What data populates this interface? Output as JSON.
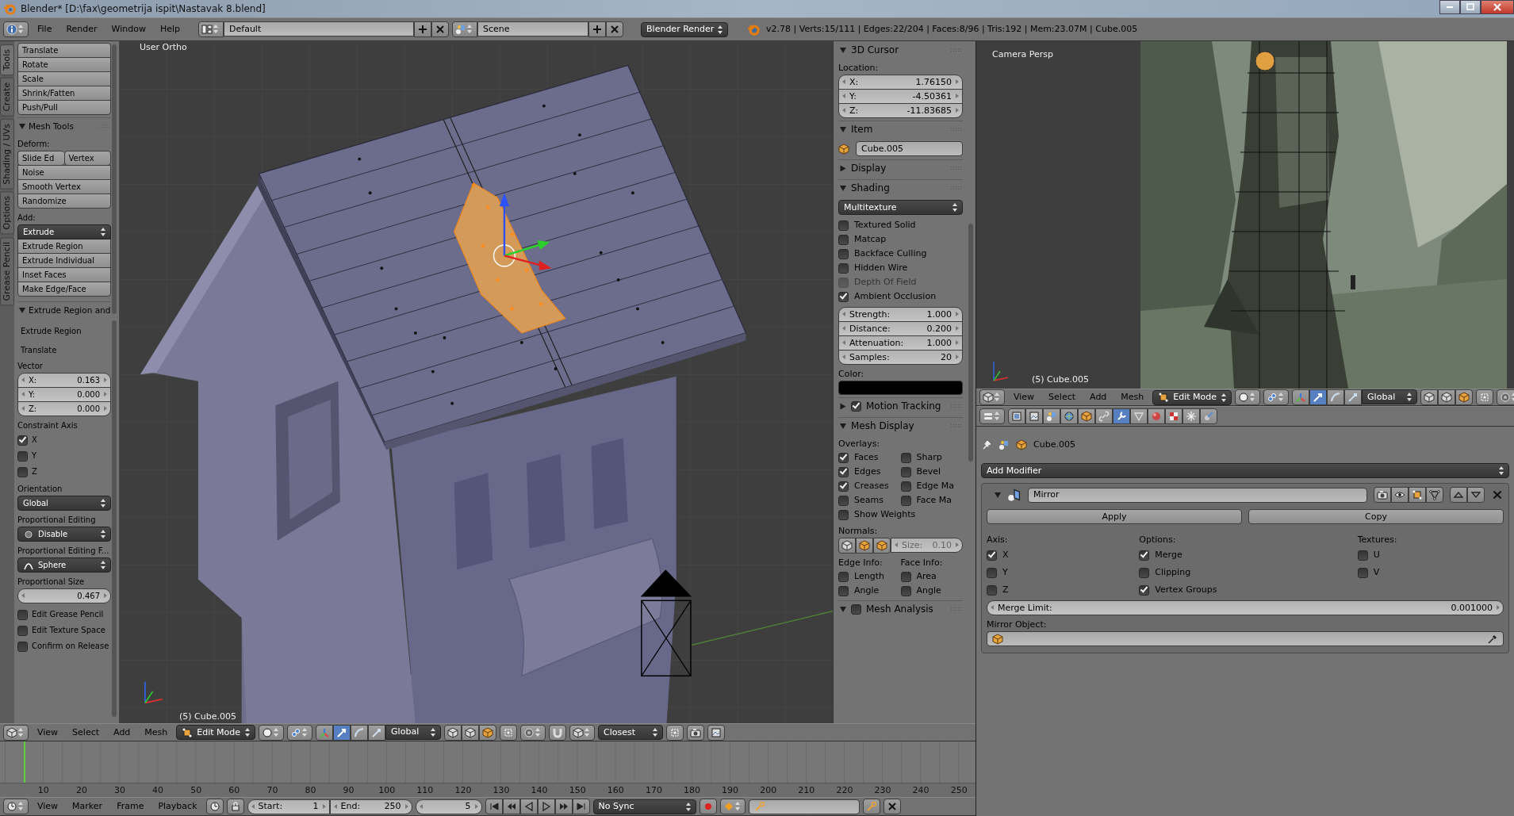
{
  "window": {
    "title": "Blender* [D:\\fax\\geometrija ispit\\Nastavak 8.blend]"
  },
  "info_header": {
    "menus": [
      "File",
      "Render",
      "Window",
      "Help"
    ],
    "screen_layout": "Default",
    "scene": "Scene",
    "render_engine": "Blender Render",
    "stats": "v2.78 | Verts:15/111 | Edges:22/204 | Faces:8/96 | Tris:192 | Mem:23.07M | Cube.005"
  },
  "tool_shelf": {
    "tabs": [
      {
        "label": "Tools",
        "selected": true
      },
      {
        "label": "Create",
        "selected": false
      },
      {
        "label": "Shading / UVs",
        "selected": false
      },
      {
        "label": "Options",
        "selected": false
      },
      {
        "label": "Grease Pencil",
        "selected": false
      }
    ],
    "transform": [
      "Translate",
      "Rotate",
      "Scale",
      "Shrink/Fatten",
      "Push/Pull"
    ],
    "mesh_tools": {
      "title": "Mesh Tools",
      "expanded": true,
      "deform_label": "Deform:",
      "deform_pair": [
        "Slide Ed",
        "Vertex"
      ],
      "deform": [
        "Noise",
        "Smooth Vertex",
        "Randomize"
      ],
      "add_label": "Add:",
      "add_menu": "Extrude",
      "add": [
        "Extrude Region",
        "Extrude Individual",
        "Inset Faces",
        "Make Edge/Face"
      ]
    }
  },
  "last_operator": {
    "title": "Extrude Region and",
    "expanded": true,
    "steps": [
      "Extrude Region",
      "Translate"
    ],
    "vector_label": "Vector",
    "vector": [
      {
        "label": "X:",
        "value": "0.163"
      },
      {
        "label": "Y:",
        "value": "0.000"
      },
      {
        "label": "Z:",
        "value": "0.000"
      }
    ],
    "constraint_label": "Constraint Axis",
    "constraint": [
      {
        "label": "X",
        "checked": true
      },
      {
        "label": "Y",
        "checked": false
      },
      {
        "label": "Z",
        "checked": false
      }
    ],
    "orientation_label": "Orientation",
    "orientation": "Global",
    "proportional_label": "Proportional Editing",
    "proportional": "Disable",
    "falloff_label": "Proportional Editing F...",
    "falloff": "Sphere",
    "size_label": "Proportional Size",
    "size": "0.467",
    "options": [
      {
        "label": "Edit Grease Pencil",
        "checked": false
      },
      {
        "label": "Edit Texture Space",
        "checked": false
      },
      {
        "label": "Confirm on Release",
        "checked": false
      }
    ]
  },
  "viewport": {
    "view_label": "User Ortho",
    "object_label": "(5) Cube.005"
  },
  "cursor_panel": {
    "title": "3D Cursor",
    "expanded": true,
    "location_label": "Location:",
    "location": [
      {
        "label": "X:",
        "value": "1.76150"
      },
      {
        "label": "Y:",
        "value": "-4.50361"
      },
      {
        "label": "Z:",
        "value": "-11.83685"
      }
    ]
  },
  "item_panel": {
    "title": "Item",
    "expanded": true,
    "object_name": "Cube.005"
  },
  "display_panel": {
    "title": "Display",
    "expanded": false
  },
  "shading_panel": {
    "title": "Shading",
    "expanded": true,
    "mode": "Multitexture",
    "toggles": [
      {
        "label": "Textured Solid",
        "checked": false,
        "disabled": false
      },
      {
        "label": "Matcap",
        "checked": false,
        "disabled": false
      },
      {
        "label": "Backface Culling",
        "checked": false,
        "disabled": false
      },
      {
        "label": "Hidden Wire",
        "checked": false,
        "disabled": false
      },
      {
        "label": "Depth Of Field",
        "checked": false,
        "disabled": true
      },
      {
        "label": "Ambient Occlusion",
        "checked": true,
        "disabled": false
      }
    ],
    "ao": [
      {
        "label": "Strength:",
        "value": "1.000"
      },
      {
        "label": "Distance:",
        "value": "0.200"
      },
      {
        "label": "Attenuation:",
        "value": "1.000"
      },
      {
        "label": "Samples:",
        "value": "20"
      }
    ],
    "color_label": "Color:"
  },
  "motion_tracking_panel": {
    "title": "Motion Tracking",
    "expanded": false,
    "checked": true
  },
  "mesh_display_panel": {
    "title": "Mesh Display",
    "expanded": true,
    "overlays_label": "Overlays:",
    "overlays": [
      {
        "label": "Faces",
        "checked": true
      },
      {
        "label": "Sharp",
        "checked": false
      },
      {
        "label": "Edges",
        "checked": true
      },
      {
        "label": "Bevel",
        "checked": false
      },
      {
        "label": "Creases",
        "checked": true
      },
      {
        "label": "Edge Ma",
        "checked": false
      },
      {
        "label": "Seams",
        "checked": false
      },
      {
        "label": "Face Ma",
        "checked": false
      }
    ],
    "show_weights": {
      "label": "Show Weights",
      "checked": false
    },
    "normals_label": "Normals:",
    "normals_size_label": "Size:",
    "normals_size": "0.10",
    "edge_info_label": "Edge Info:",
    "face_info_label": "Face Info:",
    "edge_info": [
      {
        "label": "Length",
        "checked": false
      },
      {
        "label": "Angle",
        "checked": false
      }
    ],
    "face_info": [
      {
        "label": "Area",
        "checked": false
      },
      {
        "label": "Angle",
        "checked": false
      }
    ]
  },
  "mesh_analysis_panel": {
    "title": "Mesh Analysis",
    "expanded": true,
    "checked": false
  },
  "viewport_header": {
    "menus": [
      "View",
      "Select",
      "Add",
      "Mesh"
    ],
    "mode": "Edit Mode",
    "manipulator_modes": [
      {
        "selected": true
      },
      {
        "selected": false
      },
      {
        "selected": false
      }
    ],
    "orientation": "Global",
    "snap_target": "Closest"
  },
  "timeline": {
    "ruler": [
      "10",
      "20",
      "30",
      "40",
      "50",
      "60",
      "70",
      "80",
      "90",
      "100",
      "110",
      "120",
      "130",
      "140",
      "150",
      "160",
      "170",
      "180",
      "190",
      "200",
      "210",
      "220",
      "230",
      "240",
      "250"
    ]
  },
  "timeline_header": {
    "menus": [
      "View",
      "Marker",
      "Frame",
      "Playback"
    ],
    "start_label": "Start:",
    "start": "1",
    "end_label": "End:",
    "end": "250",
    "current": "5",
    "sync": "No Sync"
  },
  "camera_view": {
    "view_label": "Camera Persp",
    "object_label": "(5) Cube.005"
  },
  "camera_header": {
    "menus": [
      "View",
      "Select",
      "Add",
      "Mesh"
    ],
    "mode": "Edit Mode",
    "manipulator_modes": [
      {
        "selected": true
      },
      {
        "selected": false
      },
      {
        "selected": false
      }
    ],
    "orientation": "Global"
  },
  "properties": {
    "tabs": [
      {
        "selected": false
      },
      {
        "selected": false
      },
      {
        "selected": false
      },
      {
        "selected": false
      },
      {
        "selected": false
      },
      {
        "selected": false
      },
      {
        "selected": true
      },
      {
        "selected": false
      },
      {
        "selected": false
      },
      {
        "selected": false
      },
      {
        "selected": false
      },
      {
        "selected": false
      }
    ],
    "breadcrumb": "Cube.005",
    "add_modifier": "Add Modifier",
    "modifier": {
      "name": "Mirror",
      "expanded": true,
      "apply": "Apply",
      "copy": "Copy",
      "axis_label": "Axis:",
      "options_label": "Options:",
      "textures_label": "Textures:",
      "axis": [
        {
          "label": "X",
          "checked": true
        },
        {
          "label": "Y",
          "checked": false
        },
        {
          "label": "Z",
          "checked": false
        }
      ],
      "options": [
        {
          "label": "Merge",
          "checked": true
        },
        {
          "label": "Clipping",
          "checked": false
        },
        {
          "label": "Vertex Groups",
          "checked": true
        }
      ],
      "textures": [
        {
          "label": "U",
          "checked": false
        },
        {
          "label": "V",
          "checked": false
        }
      ],
      "merge_limit_label": "Merge Limit:",
      "merge_limit": "0.001000",
      "mirror_object_label": "Mirror Object:"
    }
  }
}
